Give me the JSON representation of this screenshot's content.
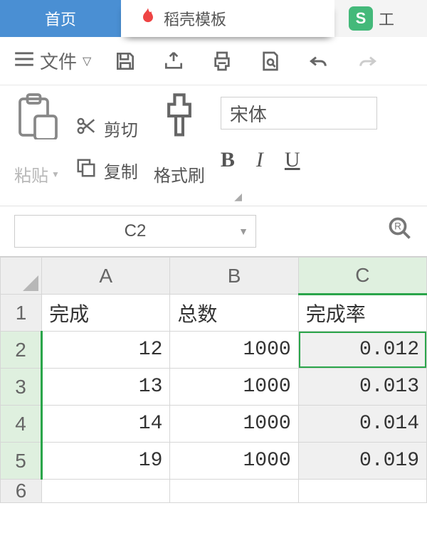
{
  "tabs": {
    "home": "首页",
    "templates": "稻壳模板",
    "spread": "工",
    "spread_badge": "S"
  },
  "file": {
    "label": "文件"
  },
  "clipboard": {
    "paste": "粘贴",
    "cut": "剪切",
    "copy": "复制",
    "format_painter": "格式刷"
  },
  "font": {
    "name": "宋体",
    "bold": "B",
    "italic": "I",
    "underline": "U"
  },
  "namebox": {
    "ref": "C2"
  },
  "sheet": {
    "cols": [
      "A",
      "B",
      "C"
    ],
    "rows": [
      "1",
      "2",
      "3",
      "4",
      "5",
      "6"
    ],
    "data": [
      [
        "完成",
        "总数",
        "完成率"
      ],
      [
        "12",
        "1000",
        "0.012"
      ],
      [
        "13",
        "1000",
        "0.013"
      ],
      [
        "14",
        "1000",
        "0.014"
      ],
      [
        "19",
        "1000",
        "0.019"
      ]
    ]
  }
}
